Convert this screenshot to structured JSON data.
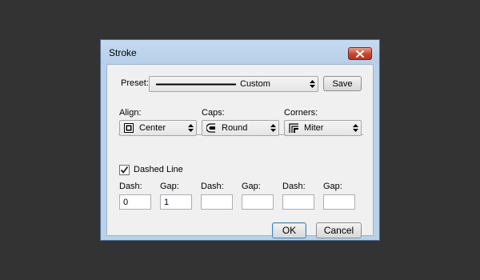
{
  "dialog": {
    "title": "Stroke",
    "close_icon": "close-x-icon"
  },
  "preset": {
    "label": "Preset:",
    "value": "Custom",
    "save_label": "Save"
  },
  "align": {
    "label": "Align:",
    "value": "Center",
    "icon": "align-center-icon"
  },
  "caps": {
    "label": "Caps:",
    "value": "Round",
    "icon": "round-cap-icon"
  },
  "corners": {
    "label": "Corners:",
    "value": "Miter",
    "icon": "miter-corner-icon"
  },
  "dashed": {
    "label": "Dashed Line",
    "checked": true
  },
  "dash_fields": [
    {
      "label": "Dash:",
      "value": "0"
    },
    {
      "label": "Gap:",
      "value": "1"
    },
    {
      "label": "Dash:",
      "value": ""
    },
    {
      "label": "Gap:",
      "value": ""
    },
    {
      "label": "Dash:",
      "value": ""
    },
    {
      "label": "Gap:",
      "value": ""
    }
  ],
  "buttons": {
    "ok": "OK",
    "cancel": "Cancel"
  },
  "colors": {
    "background": "#333333",
    "titlebar": "#b9d1ea",
    "close_button": "#c7442f",
    "client": "#f0f0f0"
  }
}
